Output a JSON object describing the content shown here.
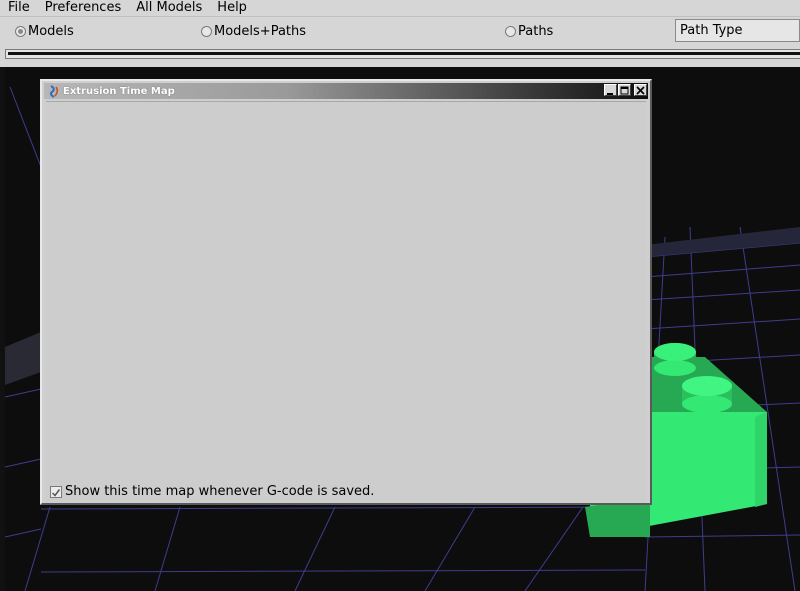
{
  "menu": [
    "File",
    "Preferences",
    "All Models",
    "Help"
  ],
  "view_modes": [
    {
      "label": "Models",
      "selected": true
    },
    {
      "label": "Models+Paths",
      "selected": false
    },
    {
      "label": "Paths",
      "selected": false
    }
  ],
  "path_type": {
    "value": "Path Type"
  },
  "dialog": {
    "title": "Extrusion Time Map",
    "show_on_save_label": "Show this time map whenever G-code is saved.",
    "show_on_save_checked": true
  },
  "colors": {
    "model_green": "#33e873",
    "grid_line": "#3d3d8f",
    "viewport_bg": "#0d0d0d"
  }
}
